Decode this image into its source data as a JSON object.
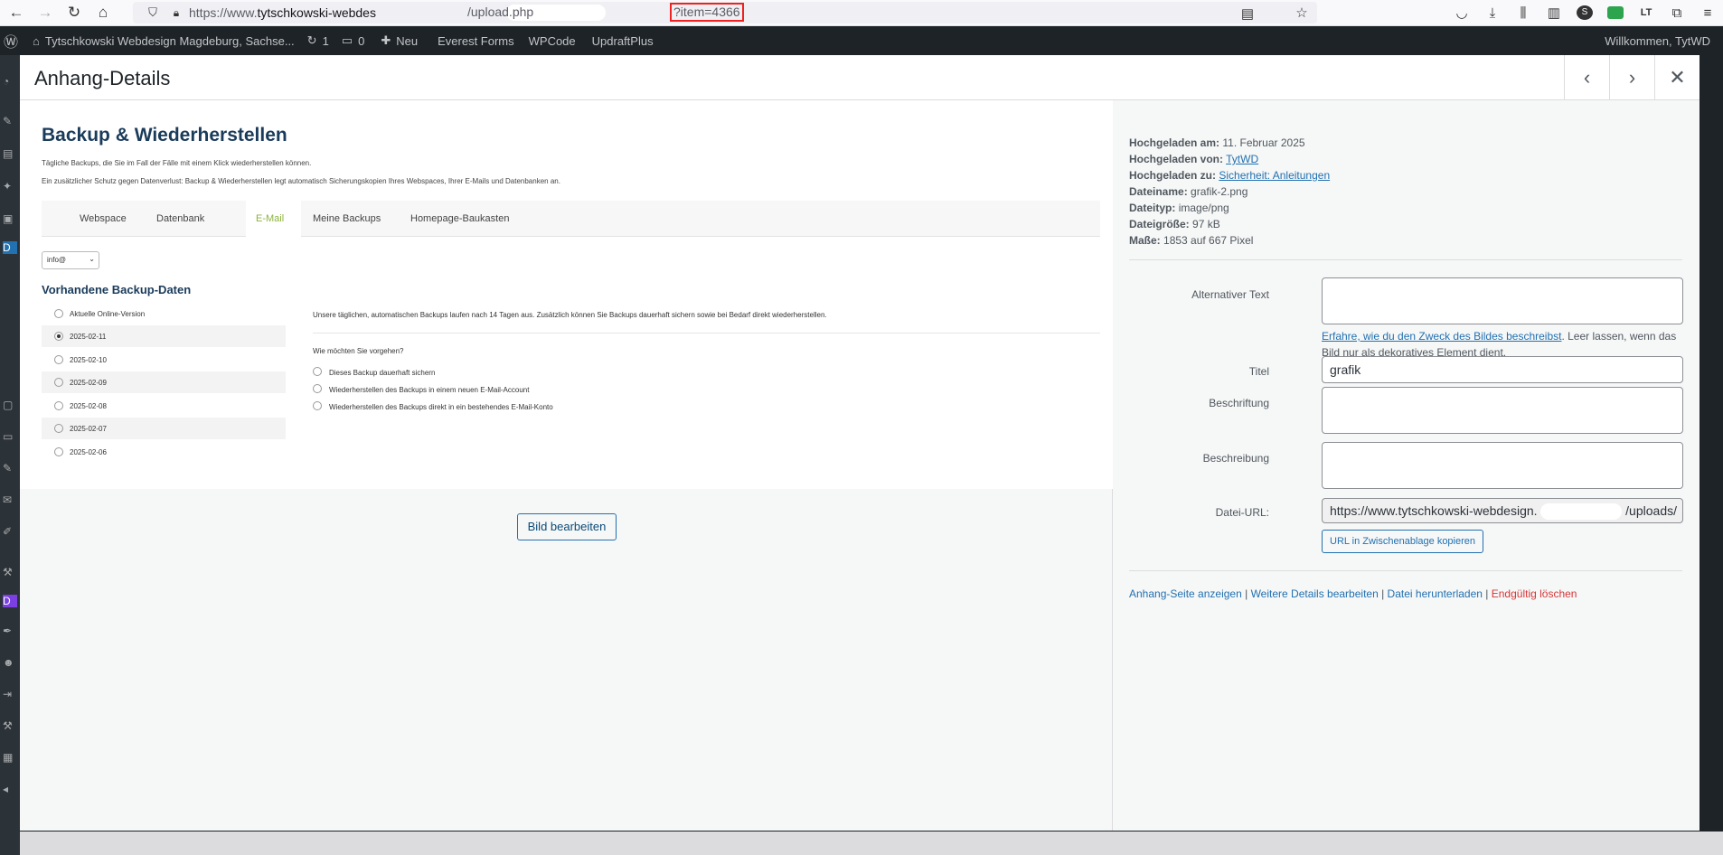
{
  "browser": {
    "url_prefix": "https://www.",
    "url_host": "tytschkowski-webdes",
    "url_path": "/upload.php",
    "url_param": "?item=4366"
  },
  "adminbar": {
    "site_name": "Tytschkowski Webdesign Magdeburg, Sachse...",
    "updates_count": "1",
    "comments_count": "0",
    "new_label": "Neu",
    "items": [
      "Everest Forms",
      "WPCode",
      "UpdraftPlus"
    ],
    "greeting": "Willkommen, TytWD"
  },
  "modal": {
    "title": "Anhang-Details",
    "edit_image_label": "Bild bearbeiten"
  },
  "preview": {
    "heading": "Backup & Wiederherstellen",
    "intro_1": "Tägliche Backups, die Sie im Fall der Fälle mit einem Klick wiederherstellen können.",
    "intro_2": "Ein zusätzlicher Schutz gegen Datenverlust: Backup & Wiederherstellen legt automatisch Sicherungskopien Ihres Webspaces, Ihrer E-Mails und Datenbanken an.",
    "tabs": [
      "Webspace",
      "Datenbank",
      "E-Mail",
      "Meine Backups",
      "Homepage-Baukasten"
    ],
    "active_tab": "E-Mail",
    "select_value": "info@",
    "backups_title": "Vorhandene Backup-Daten",
    "backups": [
      "Aktuelle Online-Version",
      "2025-02-11",
      "2025-02-10",
      "2025-02-09",
      "2025-02-08",
      "2025-02-07",
      "2025-02-06"
    ],
    "selected_backup": "2025-02-11",
    "info_text": "Unsere täglichen, automatischen Backups laufen nach 14 Tagen aus. Zusätzlich können Sie Backups dauerhaft sichern sowie bei Bedarf direkt wiederherstellen.",
    "question": "Wie möchten Sie vorgehen?",
    "options": [
      "Dieses Backup dauerhaft sichern",
      "Wiederherstellen des Backups in einem neuen E-Mail-Account",
      "Wiederherstellen des Backups direkt in ein bestehendes E-Mail-Konto"
    ]
  },
  "details": {
    "uploaded_on_label": "Hochgeladen am:",
    "uploaded_on": "11. Februar 2025",
    "uploaded_by_label": "Hochgeladen von:",
    "uploaded_by": "TytWD",
    "uploaded_to_label": "Hochgeladen zu:",
    "uploaded_to": "Sicherheit: Anleitungen",
    "filename_label": "Dateiname:",
    "filename": "grafik-2.png",
    "filetype_label": "Dateityp:",
    "filetype": "image/png",
    "filesize_label": "Dateigröße:",
    "filesize": "97 kB",
    "dimensions_label": "Maße:",
    "dimensions": "1853 auf 667 Pixel",
    "alt_label": "Alternativer Text",
    "alt_value": "",
    "alt_help_link": "Erfahre, wie du den Zweck des Bildes beschreibst",
    "alt_help_text": ". Leer lassen, wenn das Bild nur als dekoratives Element dient.",
    "title_label": "Titel",
    "title_value": "grafik",
    "caption_label": "Beschriftung",
    "caption_value": "",
    "description_label": "Beschreibung",
    "description_value": "",
    "url_label": "Datei-URL:",
    "url_value": "https://www.tytschkowski-webdesign.",
    "url_tail": "/uploads/",
    "copy_label": "URL in Zwischenablage kopieren",
    "actions": [
      "Anhang-Seite anzeigen",
      "Weitere Details bearbeiten",
      "Datei herunterladen",
      "Endgültig löschen"
    ]
  }
}
